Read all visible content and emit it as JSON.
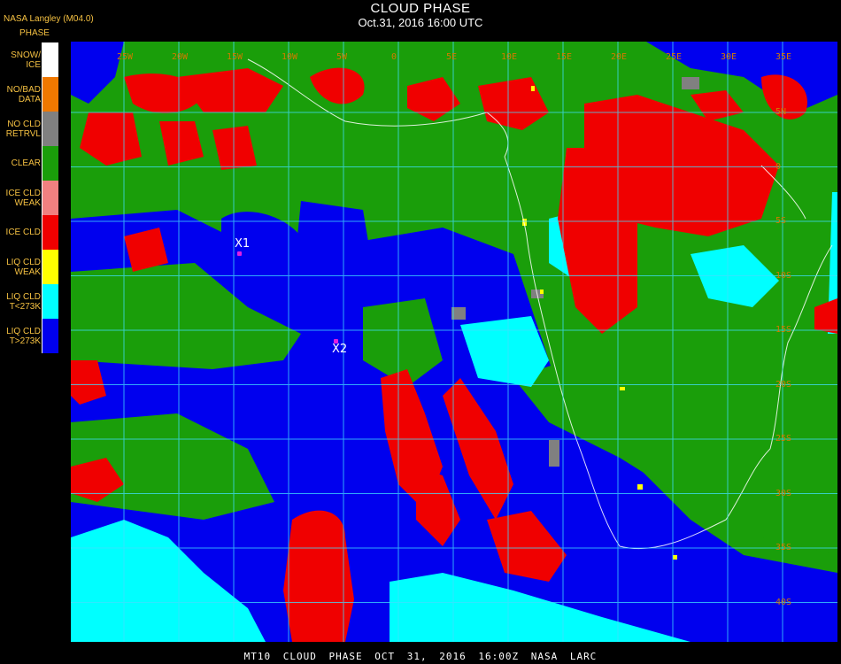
{
  "header": {
    "credit": "NASA Langley (M04.0)",
    "title": "CLOUD PHASE",
    "subtitle": "Oct.31, 2016 16:00 UTC"
  },
  "legend": {
    "title": "PHASE",
    "items": [
      {
        "lines": [
          "SNOW/",
          "ICE"
        ],
        "color": "#ffffff"
      },
      {
        "lines": [
          "NO/BAD",
          "DATA"
        ],
        "color": "#f07800"
      },
      {
        "lines": [
          "NO CLD",
          "RETRVL"
        ],
        "color": "#808080"
      },
      {
        "lines": [
          "CLEAR"
        ],
        "color": "#1a9e0a"
      },
      {
        "lines": [
          "ICE CLD",
          "WEAK"
        ],
        "color": "#f08080"
      },
      {
        "lines": [
          "ICE CLD"
        ],
        "color": "#f00000"
      },
      {
        "lines": [
          "LIQ CLD",
          "WEAK"
        ],
        "color": "#ffff00"
      },
      {
        "lines": [
          "LIQ CLD",
          "T<273K"
        ],
        "color": "#00ffff"
      },
      {
        "lines": [
          "LIQ CLD",
          "T>273K"
        ],
        "color": "#0000ee"
      }
    ]
  },
  "gridlines": {
    "longitude_labels": [
      "25W",
      "20W",
      "15W",
      "10W",
      "5W",
      "0",
      "5E",
      "10E",
      "15E",
      "20E",
      "25E",
      "30E",
      "35E"
    ],
    "latitude_labels": [
      "5N",
      "0",
      "5S",
      "10S",
      "15S",
      "20S",
      "25S",
      "30S",
      "35S",
      "40S"
    ]
  },
  "markers": [
    {
      "label": "X1"
    },
    {
      "label": "X2"
    }
  ],
  "footer": "MT10 CLOUD PHASE OCT 31, 2016 16:00Z NASA LARC"
}
